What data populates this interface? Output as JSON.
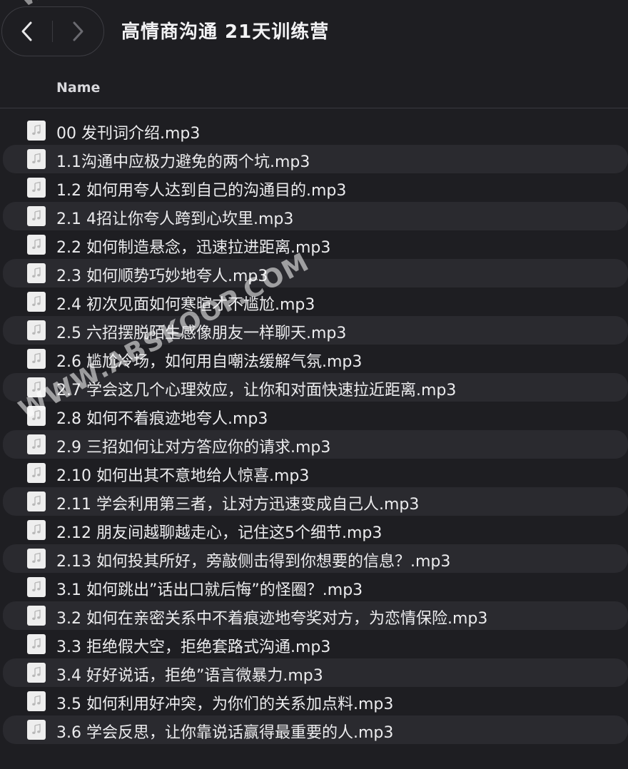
{
  "toolbar": {
    "title": "高情商沟通 21天训练营",
    "back_icon": "chevron-left-icon",
    "forward_icon": "chevron-right-icon"
  },
  "columns": {
    "name": "Name"
  },
  "files": [
    "00 发刊词介绍.mp3",
    "1.1沟通中应极力避免的两个坑.mp3",
    "1.2 如何用夸人达到自己的沟通目的.mp3",
    "2.1 4招让你夸人跨到心坎里.mp3",
    "2.2 如何制造悬念，迅速拉进距离.mp3",
    "2.3 如何顺势巧妙地夸人.mp3",
    "2.4 初次见面如何寒暄才不尴尬.mp3",
    "2.5 六招摆脱陌生感像朋友一样聊天.mp3",
    "2.6 尴尬冷场，如何用自嘲法缓解气氛.mp3",
    "2.7 学会这几个心理效应，让你和对面快速拉近距离.mp3",
    "2.8 如何不着痕迹地夸人.mp3",
    "2.9 三招如何让对方答应你的请求.mp3",
    "2.10 如何出其不意地给人惊喜.mp3",
    "2.11 学会利用第三者，让对方迅速变成自己人.mp3",
    "2.12 朋友间越聊越走心，记住这5个细节.mp3",
    "2.13 如何投其所好，旁敲侧击得到你想要的信息？.mp3",
    "3.1 如何跳出”话出口就后悔”的怪圈？.mp3",
    "3.2 如何在亲密关系中不着痕迹地夸奖对方，为恋情保险.mp3",
    "3.3 拒绝假大空，拒绝套路式沟通.mp3",
    "3.4 好好说话，拒绝”语言微暴力.mp3",
    "3.5 如何利用好冲突，为你们的关系加点料.mp3",
    "3.6 学会反思，让你靠说话赢得最重要的人.mp3"
  ],
  "file_icon": "music-file-icon",
  "watermark": "WWW.ABSKOOP.COM",
  "watermark_top": "WW",
  "colors": {
    "background": "#1e1e22",
    "row_alt": "#2a2a2f",
    "text": "#ececee"
  }
}
